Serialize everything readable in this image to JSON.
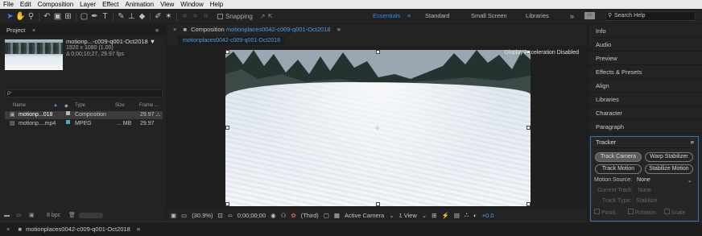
{
  "menu": [
    "File",
    "Edit",
    "Composition",
    "Layer",
    "Effect",
    "Animation",
    "View",
    "Window",
    "Help"
  ],
  "toolbar": {
    "snapping_label": "Snapping",
    "workspaces": [
      "Essentials",
      "Standard",
      "Small Screen",
      "Libraries"
    ],
    "overflow": "»",
    "search_placeholder": "Search Help"
  },
  "project": {
    "tab_label": "Project",
    "close": "×",
    "menu": "≡",
    "file_name": "motionp...-c009-q001-Oct2018 ▼",
    "file_dims": "1920 x 1080 (1.00)",
    "file_duration": "Δ 0;00;10;27, 29.97 fps",
    "search_icon": "ρ-",
    "columns": [
      "Name",
      "Type",
      "Size",
      "Frame ..."
    ],
    "rows": [
      {
        "name": "motionp...018",
        "type": "Composition",
        "size": "",
        "fps": "29.97",
        "color": "#bdb8a4",
        "selected": true
      },
      {
        "name": "motionp....mp4",
        "type": "MPEG",
        "size": "... MB",
        "fps": "29.97",
        "color": "#4fa8b8",
        "selected": false
      }
    ],
    "bpc": "8 bpc"
  },
  "composition": {
    "tab_prefix": "Composition",
    "tab_name": "motionplaces0042-c009-q001-Oct2018",
    "tab_menu": "≡",
    "breadcrumb": "motionplaces0042-c009-q001-Oct2018",
    "display_accel": "Display Acceleration Disabled",
    "zoom": "(30.9%)",
    "timecode": "0;00;00;00",
    "resolution": "(Third)",
    "camera": "Active Camera",
    "views": "1 View",
    "exposure": "+0.0"
  },
  "panels": [
    "Info",
    "Audio",
    "Preview",
    "Effects & Presets",
    "Align",
    "Libraries",
    "Character",
    "Paragraph"
  ],
  "tracker": {
    "title": "Tracker",
    "menu": "≡",
    "buttons": [
      "Track Camera",
      "Warp Stabilizer",
      "Track Motion",
      "Stabilize Motion"
    ],
    "motion_source_label": "Motion Source:",
    "motion_source_value": "None",
    "current_track_label": "Current Track:",
    "current_track_value": "None",
    "track_type_label": "Track Type:",
    "track_type_value": "Stabilize",
    "options": [
      "Positi...",
      "Rotation",
      "Scale"
    ]
  },
  "status": {
    "close": "×",
    "comp_name": "motionplaces0042-c009-q001-Oct2018",
    "menu": "≡"
  }
}
